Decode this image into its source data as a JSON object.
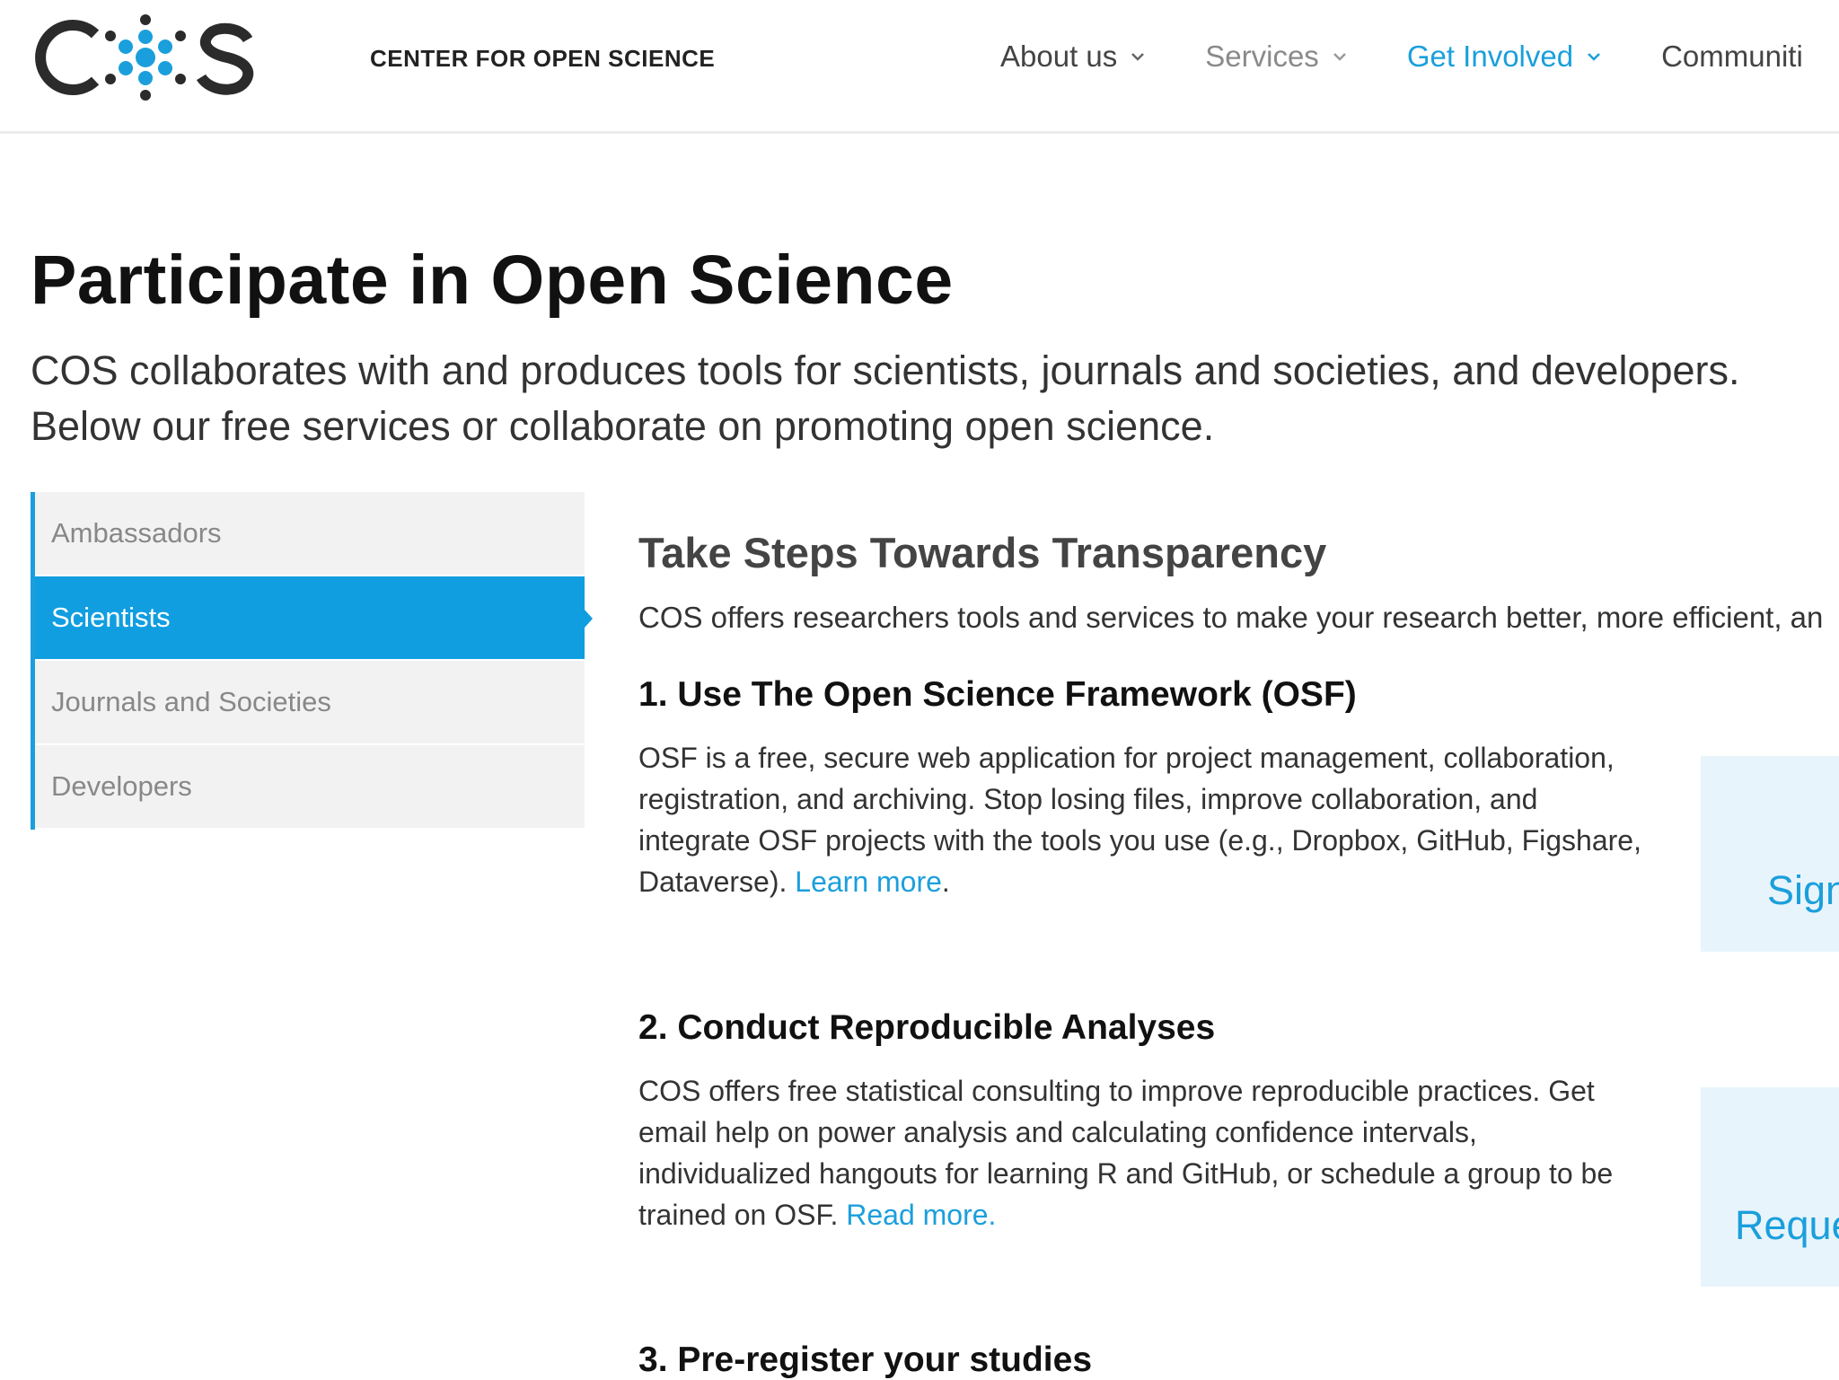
{
  "header": {
    "logo_text": "COS",
    "tagline": "CENTER FOR OPEN SCIENCE",
    "nav": [
      {
        "label": "About us"
      },
      {
        "label": "Services"
      },
      {
        "label": "Get Involved"
      },
      {
        "label": "Communiti"
      }
    ]
  },
  "page": {
    "title": "Participate in Open Science",
    "intro": "COS collaborates with and produces tools for scientists, journals and societies, and developers. Below our free services or collaborate on promoting open science."
  },
  "sidebar": {
    "items": [
      {
        "label": "Ambassadors"
      },
      {
        "label": "Scientists"
      },
      {
        "label": "Journals and Societies"
      },
      {
        "label": "Developers"
      }
    ]
  },
  "main": {
    "section_title": "Take Steps Towards Transparency",
    "lead": "COS offers researchers tools and services to make your research better, more efficient, an",
    "steps": [
      {
        "title": "1. Use The Open Science Framework (OSF)",
        "body": "OSF is a free, secure web application for project management, collaboration, registration, and archiving. Stop losing files, improve collaboration, and integrate OSF projects with the tools you use (e.g., Dropbox, GitHub, Figshare, Dataverse).",
        "link": "Learn more",
        "suffix": ".",
        "cta": "Sign"
      },
      {
        "title": "2. Conduct Reproducible Analyses",
        "body": "COS offers free statistical consulting to improve reproducible practices. Get email help on power analysis and calculating confidence intervals, individualized hangouts for learning R and GitHub, or schedule a group to be trained on OSF.",
        "link": "Read more.",
        "cta": "Reque"
      },
      {
        "title": "3. Pre-register your studies"
      }
    ]
  },
  "colors": {
    "accent": "#1b9fdc",
    "sidebar_active": "#119ee0",
    "sidebar_bg": "#f2f2f2",
    "cta_bg": "#e8f4fb"
  }
}
